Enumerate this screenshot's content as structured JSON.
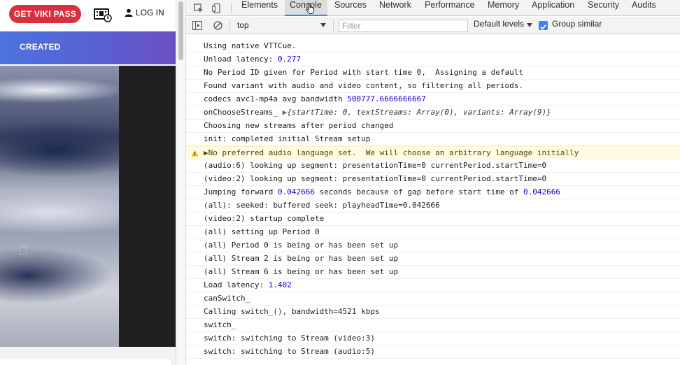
{
  "site": {
    "pass_button": "GET VIKI PASS",
    "login_label": "LOG IN",
    "created_label": "CREATED"
  },
  "devtools": {
    "tabs": [
      "Elements",
      "Console",
      "Sources",
      "Network",
      "Performance",
      "Memory",
      "Application",
      "Security",
      "Audits"
    ],
    "active_tab": "Console",
    "toolbar": {
      "context": "top",
      "filter_placeholder": "Filter",
      "levels_label": "Default levels",
      "group_similar_label": "Group similar",
      "group_similar_checked": true
    },
    "accent": "#3e82f7",
    "console_rows": [
      {
        "kind": "log",
        "parts": [
          {
            "t": "Using native VTTCue."
          }
        ]
      },
      {
        "kind": "log",
        "parts": [
          {
            "t": "Unload latency: "
          },
          {
            "t": "0.277",
            "c": "num"
          }
        ]
      },
      {
        "kind": "log",
        "parts": [
          {
            "t": "No Period ID given for Period with start time 0,  Assigning a default"
          }
        ]
      },
      {
        "kind": "log",
        "parts": [
          {
            "t": "Found variant with audio and video content, so filtering all periods."
          }
        ]
      },
      {
        "kind": "log",
        "parts": [
          {
            "t": "codecs avc1-mp4a avg bandwidth "
          },
          {
            "t": "500777.6666666667",
            "c": "num"
          }
        ]
      },
      {
        "kind": "log",
        "parts": [
          {
            "t": "onChooseStreams_ "
          },
          {
            "t": "▶",
            "c": "tri"
          },
          {
            "t": "{startTime: ",
            "c": "obj"
          },
          {
            "t": "0",
            "c": "num obj"
          },
          {
            "t": ", textStreams: Array(0), variants: Array(9)}",
            "c": "obj"
          }
        ]
      },
      {
        "kind": "log",
        "parts": [
          {
            "t": "Choosing new streams after period changed"
          }
        ]
      },
      {
        "kind": "log",
        "parts": [
          {
            "t": "init: completed initial Stream setup"
          }
        ]
      },
      {
        "kind": "warn",
        "parts": [
          {
            "t": "▶No preferred audio language set.  We will choose an arbitrary language initially"
          }
        ]
      },
      {
        "kind": "log",
        "parts": [
          {
            "t": "(audio:6) looking up segment: presentationTime=0 currentPeriod.startTime=0"
          }
        ]
      },
      {
        "kind": "log",
        "parts": [
          {
            "t": "(video:2) looking up segment: presentationTime=0 currentPeriod.startTime=0"
          }
        ]
      },
      {
        "kind": "log",
        "parts": [
          {
            "t": "Jumping forward "
          },
          {
            "t": "0.042666",
            "c": "num"
          },
          {
            "t": " seconds because of gap before start time of "
          },
          {
            "t": "0.042666",
            "c": "num"
          }
        ]
      },
      {
        "kind": "log",
        "parts": [
          {
            "t": "(all): seeked: buffered seek: playheadTime=0.042666"
          }
        ]
      },
      {
        "kind": "log",
        "parts": [
          {
            "t": "(video:2) startup complete"
          }
        ]
      },
      {
        "kind": "log",
        "parts": [
          {
            "t": "(all) setting up Period 0"
          }
        ]
      },
      {
        "kind": "log",
        "parts": [
          {
            "t": "(all) Period 0 is being or has been set up"
          }
        ]
      },
      {
        "kind": "log",
        "parts": [
          {
            "t": "(all) Stream 2 is being or has been set up"
          }
        ]
      },
      {
        "kind": "log",
        "parts": [
          {
            "t": "(all) Stream 6 is being or has been set up"
          }
        ]
      },
      {
        "kind": "log",
        "parts": [
          {
            "t": "Load latency: "
          },
          {
            "t": "1.402",
            "c": "num"
          }
        ]
      },
      {
        "kind": "log",
        "parts": [
          {
            "t": "canSwitch_"
          }
        ]
      },
      {
        "kind": "log",
        "parts": [
          {
            "t": "Calling switch_(), bandwidth=4521 kbps"
          }
        ]
      },
      {
        "kind": "log",
        "parts": [
          {
            "t": "switch_"
          }
        ]
      },
      {
        "kind": "log",
        "parts": [
          {
            "t": "switch: switching to Stream (video:3)"
          }
        ]
      },
      {
        "kind": "log",
        "parts": [
          {
            "t": "switch: switching to Stream (audio:5)"
          }
        ]
      }
    ]
  }
}
